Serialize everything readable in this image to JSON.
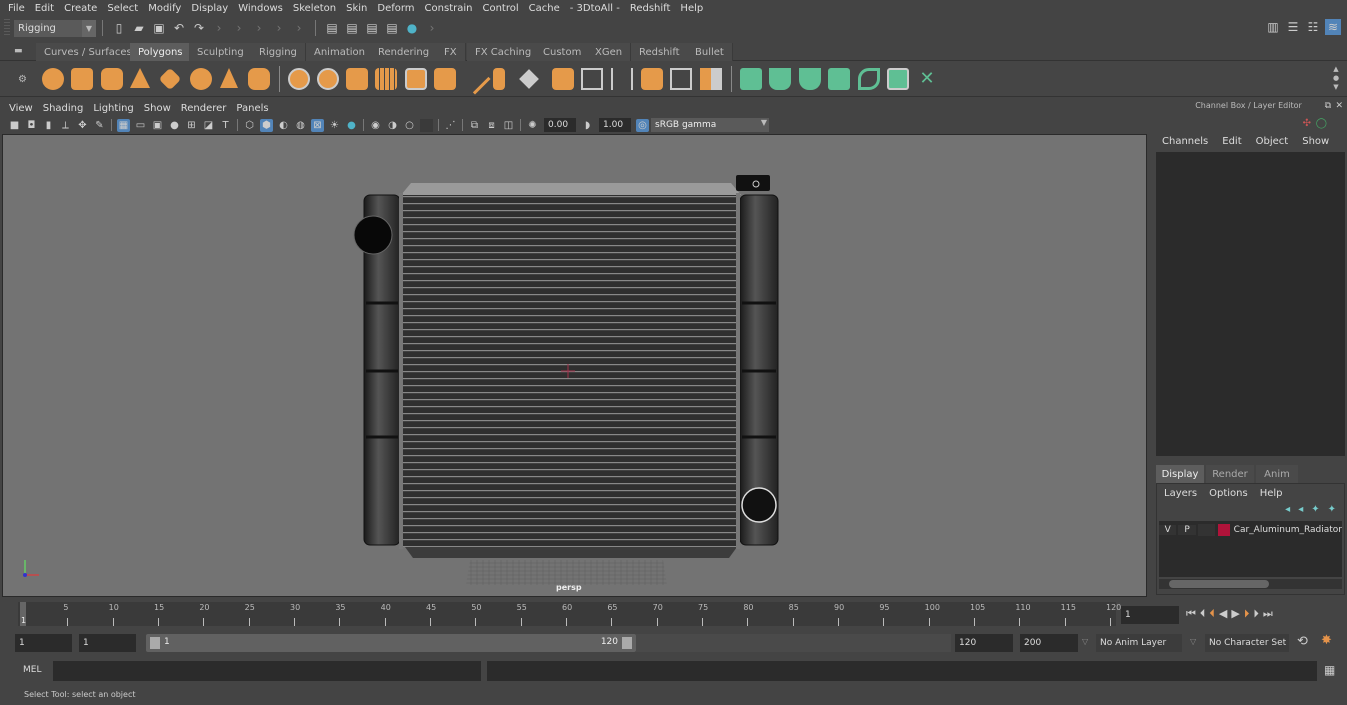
{
  "menubar": [
    "File",
    "Edit",
    "Create",
    "Select",
    "Modify",
    "Display",
    "Windows",
    "Skeleton",
    "Skin",
    "Deform",
    "Constrain",
    "Control",
    "Cache",
    "- 3DtoAll -",
    "Redshift",
    "Help"
  ],
  "status_line": {
    "mode": "Rigging",
    "icons": [
      "new-scene-icon",
      "open-scene-icon",
      "save-scene-icon",
      "undo-icon",
      "redo-icon",
      "render-view-icon",
      "render-frame-icon",
      "ipr-render-icon",
      "render-settings-icon",
      "hypershade-icon"
    ]
  },
  "shelf": {
    "tabs": [
      "Curves / Surfaces",
      "Polygons",
      "Sculpting",
      "Rigging",
      "Animation",
      "Rendering",
      "FX",
      "FX Caching",
      "Custom",
      "XGen",
      "Redshift",
      "Bullet"
    ],
    "active_tab": "Polygons",
    "poly_icons": [
      "sphere-icon",
      "cube-icon",
      "cylinder-icon",
      "cone-icon",
      "plane-diamond-icon",
      "torus-icon",
      "pyramid-icon",
      "pipe-icon"
    ],
    "tool_icons": [
      "combine-icon",
      "separate-icon",
      "mirror-icon",
      "smooth-icon",
      "extrude-icon",
      "bridge-icon",
      "append-icon",
      "multi-cut-icon",
      "bevel-icon",
      "merge-icon",
      "boolean-icon",
      "fill-hole-icon",
      "triangulate-icon",
      "quadrangulate-icon",
      "soften-edge-icon",
      "reduce-icon"
    ],
    "uv_icons": [
      "uv-planar-icon",
      "uv-cylindrical-icon",
      "uv-spherical-icon",
      "uv-automatic-icon",
      "uv-contour-icon",
      "uv-editor-icon",
      "uv-unfold-icon"
    ]
  },
  "viewport": {
    "menu": [
      "View",
      "Shading",
      "Lighting",
      "Show",
      "Renderer",
      "Panels"
    ],
    "exposure": "0.00",
    "gamma": "1.00",
    "color_space": "sRGB gamma",
    "camera_label": "persp",
    "model_name": "Car_Aluminum_Radiator"
  },
  "right_panel": {
    "title": "Channel Box / Layer Editor",
    "channel_menu": [
      "Channels",
      "Edit",
      "Object",
      "Show"
    ],
    "layer_tabs": [
      "Display",
      "Render",
      "Anim"
    ],
    "active_layer_tab": "Display",
    "layer_menu": [
      "Layers",
      "Options",
      "Help"
    ],
    "layers": [
      {
        "v": "V",
        "p": "P",
        "color": "#b0133a",
        "name": "Car_Aluminum_Radiator"
      }
    ]
  },
  "timeline": {
    "ticks": [
      "5",
      "10",
      "15",
      "20",
      "25",
      "30",
      "35",
      "40",
      "45",
      "50",
      "55",
      "60",
      "65",
      "70",
      "75",
      "80",
      "85",
      "90",
      "95",
      "100",
      "105",
      "110",
      "115",
      "120"
    ],
    "current_marker": "1",
    "current_frame": "1"
  },
  "range": {
    "start": "1",
    "anim_start": "1",
    "slider_start": "1",
    "slider_end": "120",
    "end": "120",
    "anim_end": "200",
    "anim_layer": "No Anim Layer",
    "character_set": "No Character Set"
  },
  "command_line": {
    "label": "MEL"
  },
  "help_line": "Select Tool: select an object"
}
